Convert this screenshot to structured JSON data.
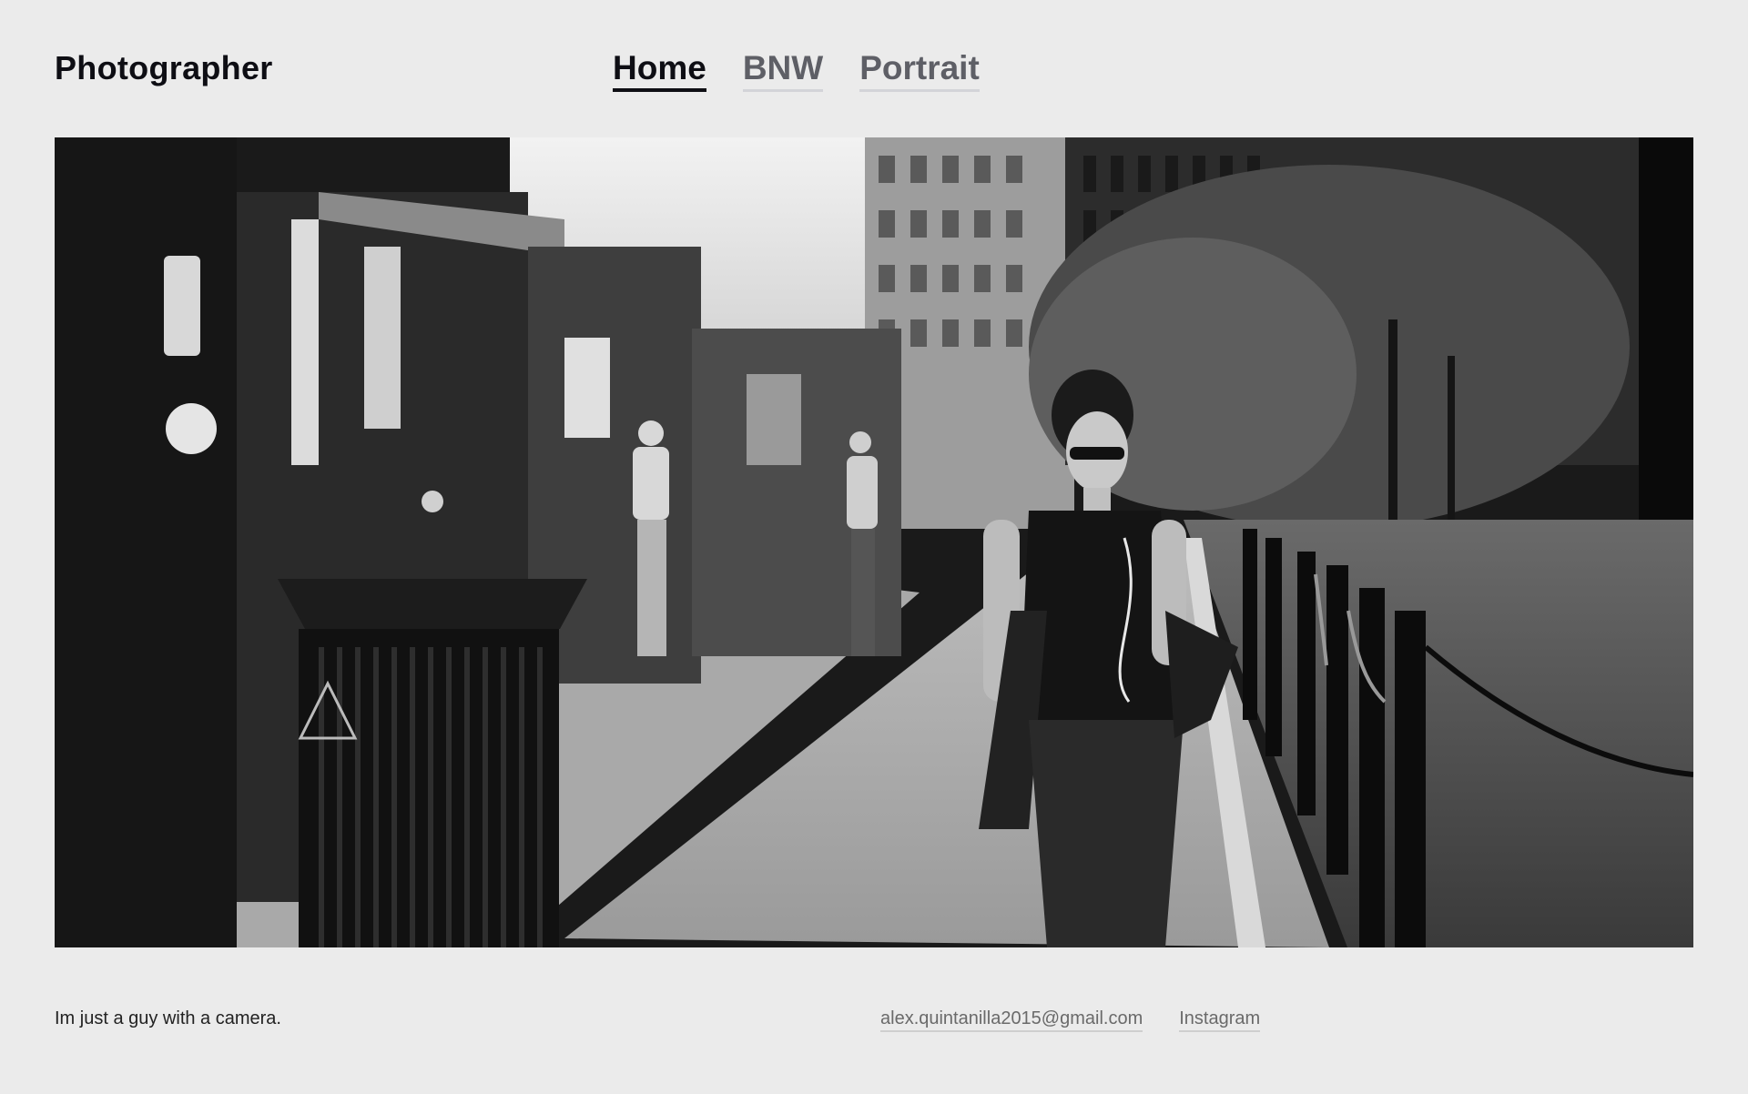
{
  "header": {
    "site_title": "Photographer",
    "nav": [
      {
        "label": "Home",
        "active": true
      },
      {
        "label": "BNW",
        "active": false
      },
      {
        "label": "Portrait",
        "active": false
      }
    ]
  },
  "hero": {
    "image_icon": "street-photo-black-and-white"
  },
  "footer": {
    "tagline": "Im just a guy with a camera.",
    "email": "alex.quintanilla2015@gmail.com",
    "social": "Instagram"
  },
  "colors": {
    "background": "#ebebeb",
    "text_primary": "#0e0e14",
    "nav_inactive": "#5e5f66"
  }
}
